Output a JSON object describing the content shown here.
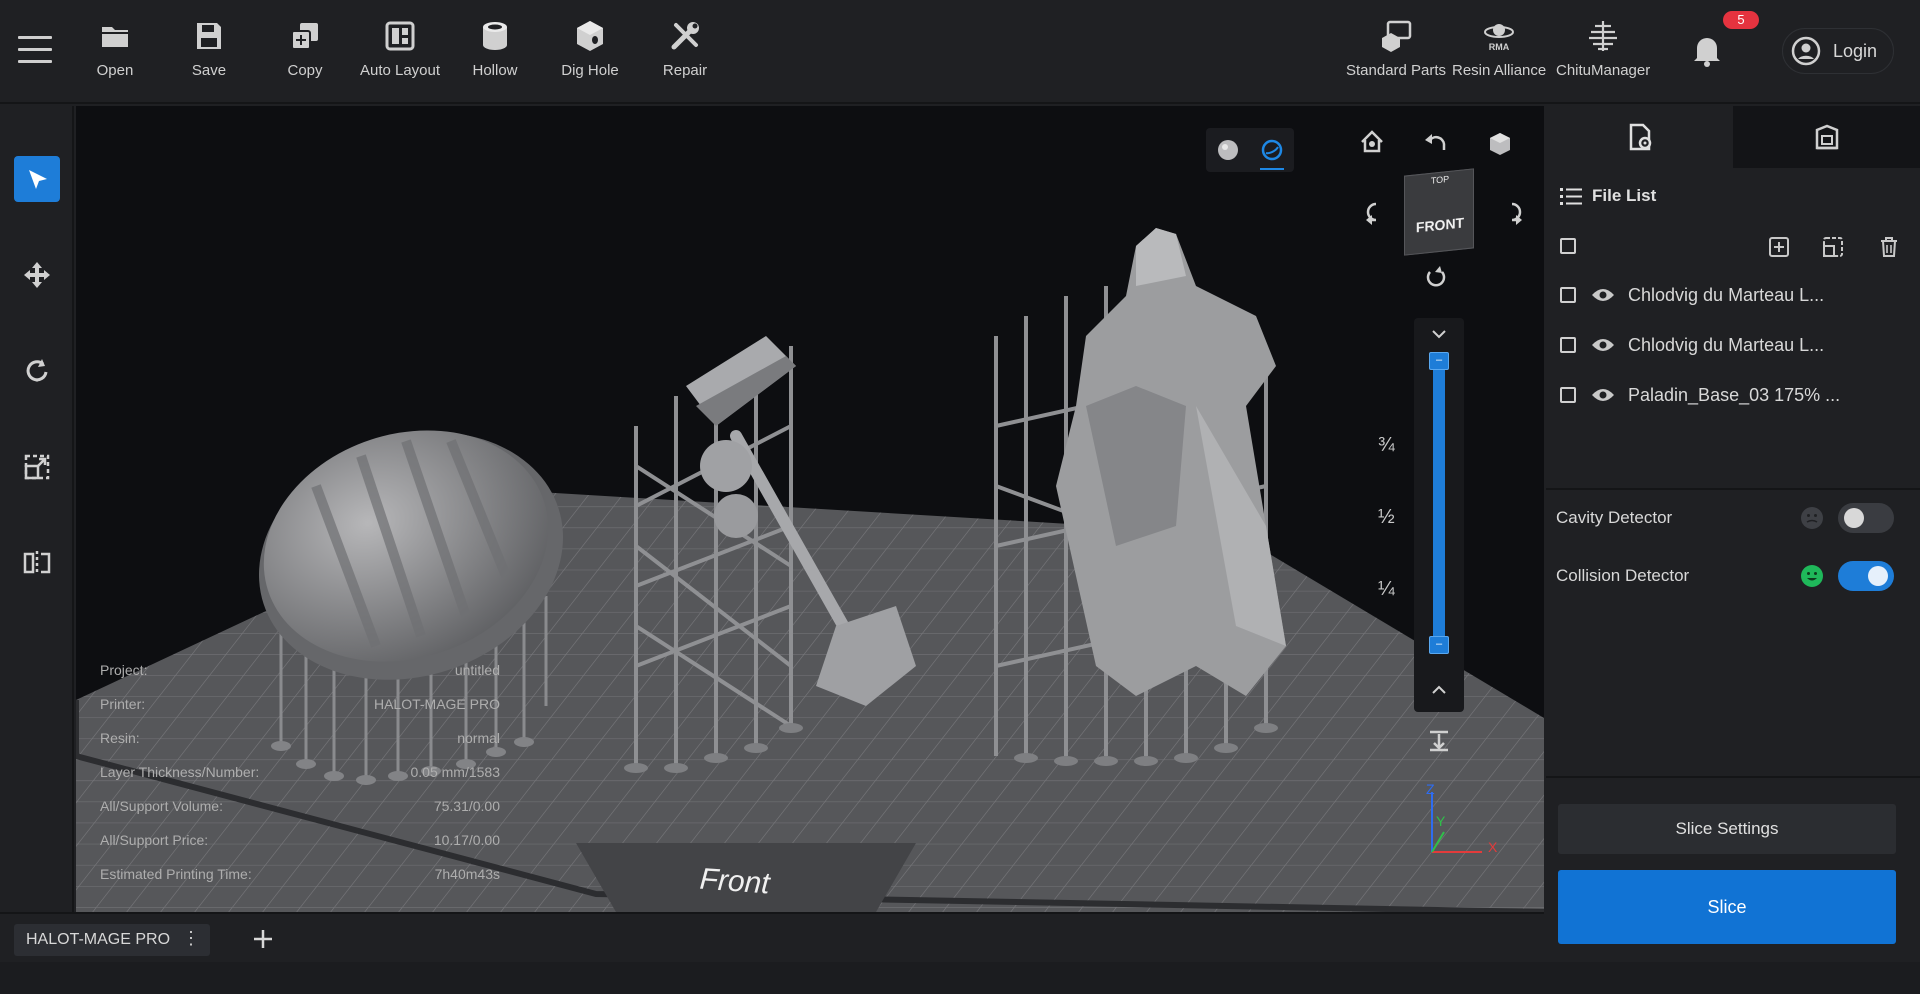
{
  "toolbar": {
    "tools": [
      {
        "label": "Open",
        "icon": "folder-icon"
      },
      {
        "label": "Save",
        "icon": "save-icon"
      },
      {
        "label": "Copy",
        "icon": "copy-icon"
      },
      {
        "label": "Auto Layout",
        "icon": "layout-icon"
      },
      {
        "label": "Hollow",
        "icon": "hollow-icon"
      },
      {
        "label": "Dig Hole",
        "icon": "dig-hole-icon"
      },
      {
        "label": "Repair",
        "icon": "repair-icon"
      }
    ],
    "right_tools": [
      {
        "label": "Standard Parts",
        "icon": "parts-icon"
      },
      {
        "label": "Resin Alliance",
        "icon": "rma-icon",
        "icon_text": "RMA"
      },
      {
        "label": "ChituManager",
        "icon": "chitu-icon"
      }
    ],
    "notification_count": "5",
    "login_label": "Login"
  },
  "left_tools": [
    {
      "name": "select-tool",
      "icon": "cursor-icon",
      "active": true
    },
    {
      "name": "move-tool",
      "icon": "move-icon",
      "active": false
    },
    {
      "name": "rotate-tool",
      "icon": "rotate-icon",
      "active": false
    },
    {
      "name": "scale-tool",
      "icon": "scale-icon",
      "active": false
    },
    {
      "name": "mirror-tool",
      "icon": "mirror-icon",
      "active": false
    }
  ],
  "viewport": {
    "view_cube_label": "FRONT",
    "view_cube_top": "TOP",
    "plate_label": "Front",
    "slider_ticks": [
      "¾",
      "½",
      "¼"
    ],
    "axes": {
      "x": "X",
      "y": "Y",
      "z": "Z"
    }
  },
  "project_info": [
    {
      "key": "Project:",
      "value": "untitled"
    },
    {
      "key": "Printer:",
      "value": "HALOT-MAGE PRO"
    },
    {
      "key": "Resin:",
      "value": "normal"
    },
    {
      "key": "Layer Thickness/Number:",
      "value": "0.05 mm/1583"
    },
    {
      "key": "All/Support Volume:",
      "value": "75.31/0.00"
    },
    {
      "key": "All/Support Price:",
      "value": "10.17/0.00"
    },
    {
      "key": "Estimated Printing Time:",
      "value": "7h40m43s"
    }
  ],
  "side_panel": {
    "file_list_title": "File List",
    "files": [
      "Chlodvig du Marteau L...",
      "Chlodvig du Marteau L...",
      "Paladin_Base_03 175% ..."
    ],
    "cavity_detector": {
      "label": "Cavity Detector",
      "enabled": false
    },
    "collision_detector": {
      "label": "Collision Detector",
      "enabled": true
    },
    "slice_settings_label": "Slice Settings",
    "slice_label": "Slice"
  },
  "bottom": {
    "printer_tab": "HALOT-MAGE PRO",
    "more_glyph": "⋮"
  },
  "colors": {
    "accent": "#1e7dd8",
    "badge": "#e5333f",
    "ok_face": "#1fb85a"
  }
}
